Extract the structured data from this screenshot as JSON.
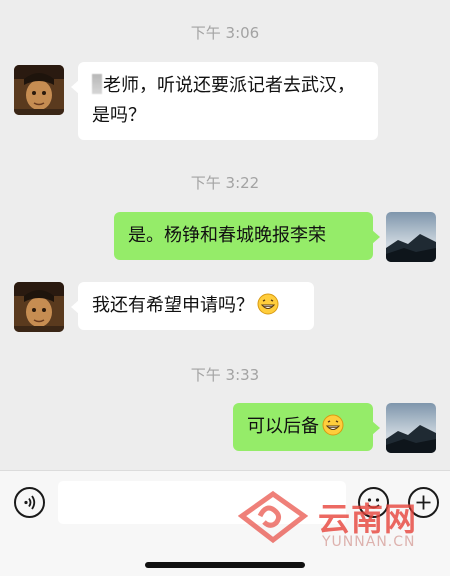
{
  "messages": {
    "time_1": "下午 3:06",
    "msg_1_text": "老师，听说还要派记者去武汉，是吗？",
    "time_2": "下午 3:22",
    "msg_2_text": "是。杨铮和春城晚报李荣",
    "msg_3_text": "我还有希望申请吗？",
    "time_3": "下午 3:33",
    "msg_4_text": "可以后备"
  },
  "input_bar": {
    "input_value": "",
    "icons": [
      "voice-icon",
      "emoji-icon",
      "plus-icon"
    ]
  },
  "watermark": {
    "brand_name": "云南网",
    "url": "YUNNAN.CN"
  },
  "colors": {
    "background": "#ededed",
    "bubble_sent": "#95ec69",
    "bubble_received": "#ffffff",
    "watermark_red": "#e8443b"
  }
}
